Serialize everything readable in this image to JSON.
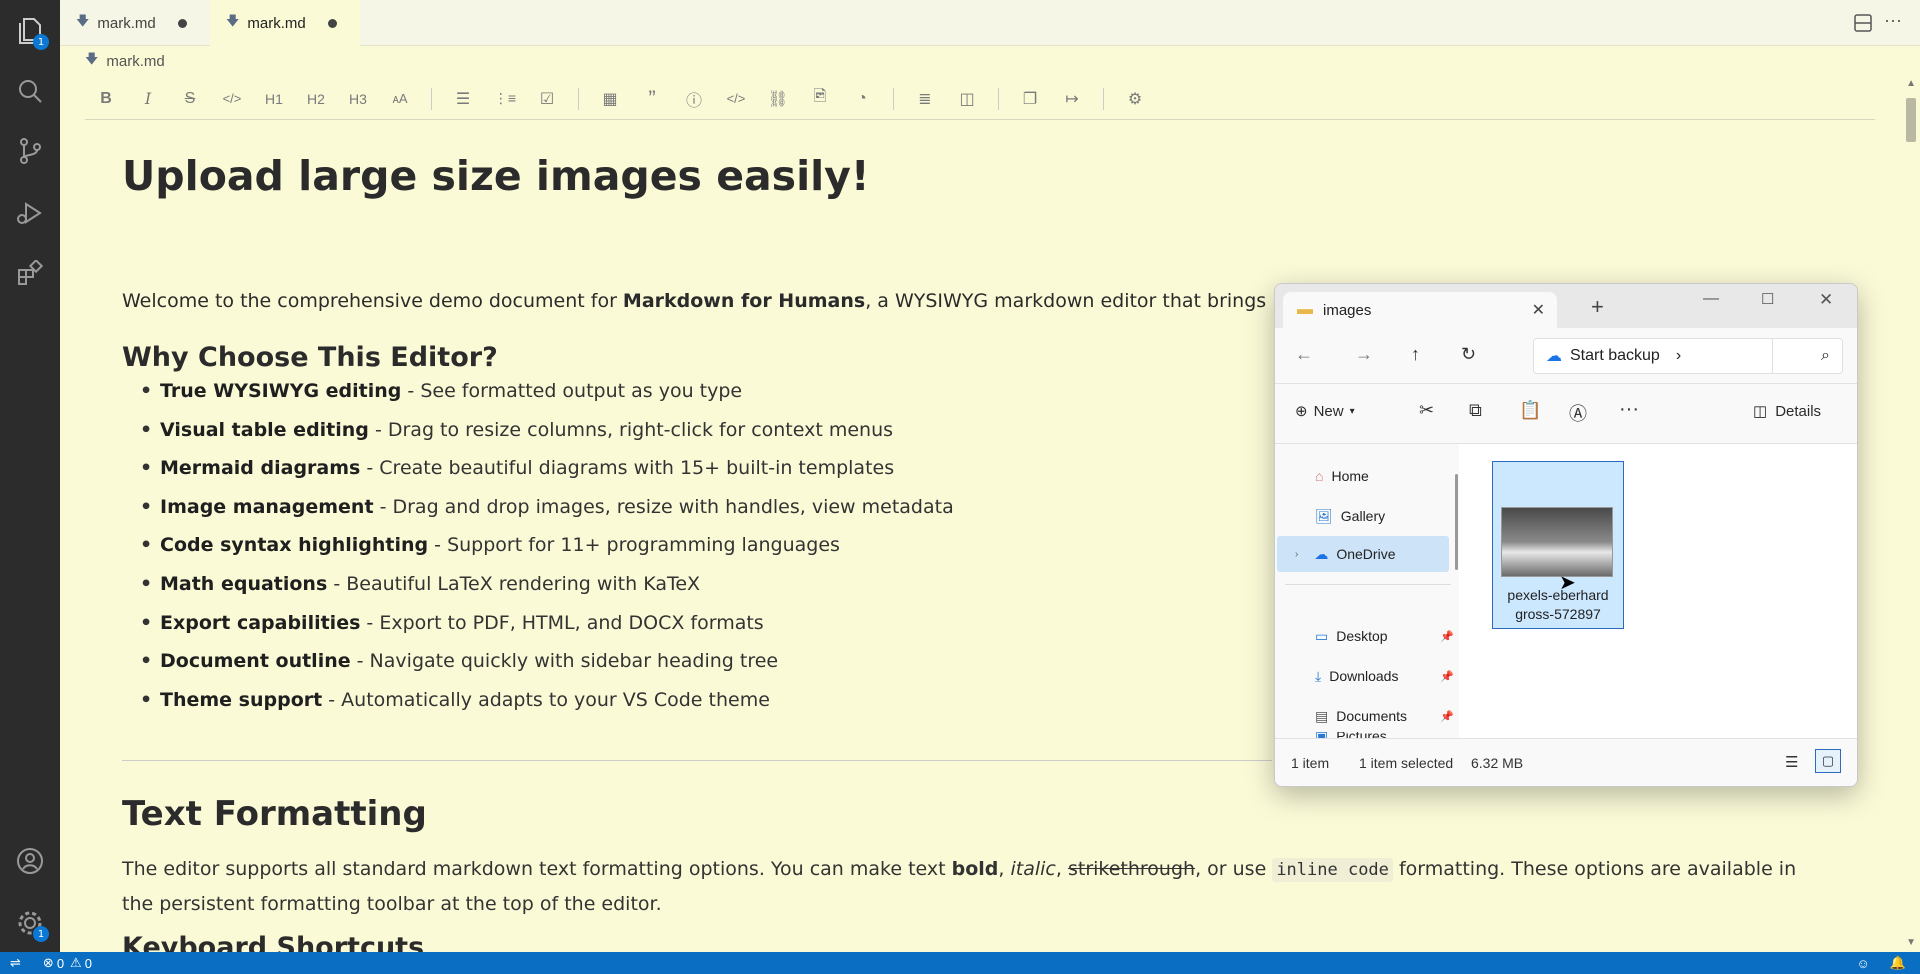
{
  "activity": {
    "explorer_badge": "1",
    "settings_badge": "1"
  },
  "tabs": [
    {
      "label": "mark.md",
      "unsaved": true
    },
    {
      "label": "mark.md",
      "unsaved": true
    }
  ],
  "breadcrumb": "mark.md",
  "toolbar": {
    "h1": "H1",
    "h2": "H2",
    "h3": "H3"
  },
  "doc": {
    "title": "Upload large size images easily!",
    "intro_pre": "Welcome to the comprehensive demo document for ",
    "intro_bold": "Markdown for Humans",
    "intro_post": ", a WYSIWYG markdown editor that brings a me",
    "why_heading": "Why Choose This Editor?",
    "features": [
      {
        "bold": "True WYSIWYG editing",
        "text": " - See formatted output as you type"
      },
      {
        "bold": "Visual table editing",
        "text": " - Drag to resize columns, right-click for context menus"
      },
      {
        "bold": "Mermaid diagrams",
        "text": " - Create beautiful diagrams with 15+ built-in templates"
      },
      {
        "bold": "Image management",
        "text": " - Drag and drop images, resize with handles, view metadata"
      },
      {
        "bold": "Code syntax highlighting",
        "text": " - Support for 11+ programming languages"
      },
      {
        "bold": "Math equations",
        "text": " - Beautiful LaTeX rendering with KaTeX"
      },
      {
        "bold": "Export capabilities",
        "text": " - Export to PDF, HTML, and DOCX formats"
      },
      {
        "bold": "Document outline",
        "text": " - Navigate quickly with sidebar heading tree"
      },
      {
        "bold": "Theme support",
        "text": " - Automatically adapts to your VS Code theme"
      }
    ],
    "text_formatting_heading": "Text Formatting",
    "tf_1": "The editor supports all standard markdown text formatting options. You can make text ",
    "tf_bold": "bold",
    "tf_comma1": ", ",
    "tf_italic": "italic",
    "tf_comma2": ", ",
    "tf_strike": "strikethrough",
    "tf_2": ", or use ",
    "tf_code": "inline code",
    "tf_3": " formatting. These options are available in the persistent formatting toolbar at the top of the editor.",
    "keyboard_heading": "Keyboard Shortcuts"
  },
  "status": {
    "errors": "0",
    "warnings": "0"
  },
  "explorer": {
    "tab_title": "images",
    "address": "Start backup",
    "new_label": "New",
    "details_label": "Details",
    "nav": [
      "Home",
      "Gallery",
      "OneDrive",
      "Desktop",
      "Downloads",
      "Documents",
      "Pictures"
    ],
    "file_name": "pexels-eberhard gross-572897",
    "count": "1 item",
    "selected": "1 item selected",
    "size": "6.32 MB"
  }
}
